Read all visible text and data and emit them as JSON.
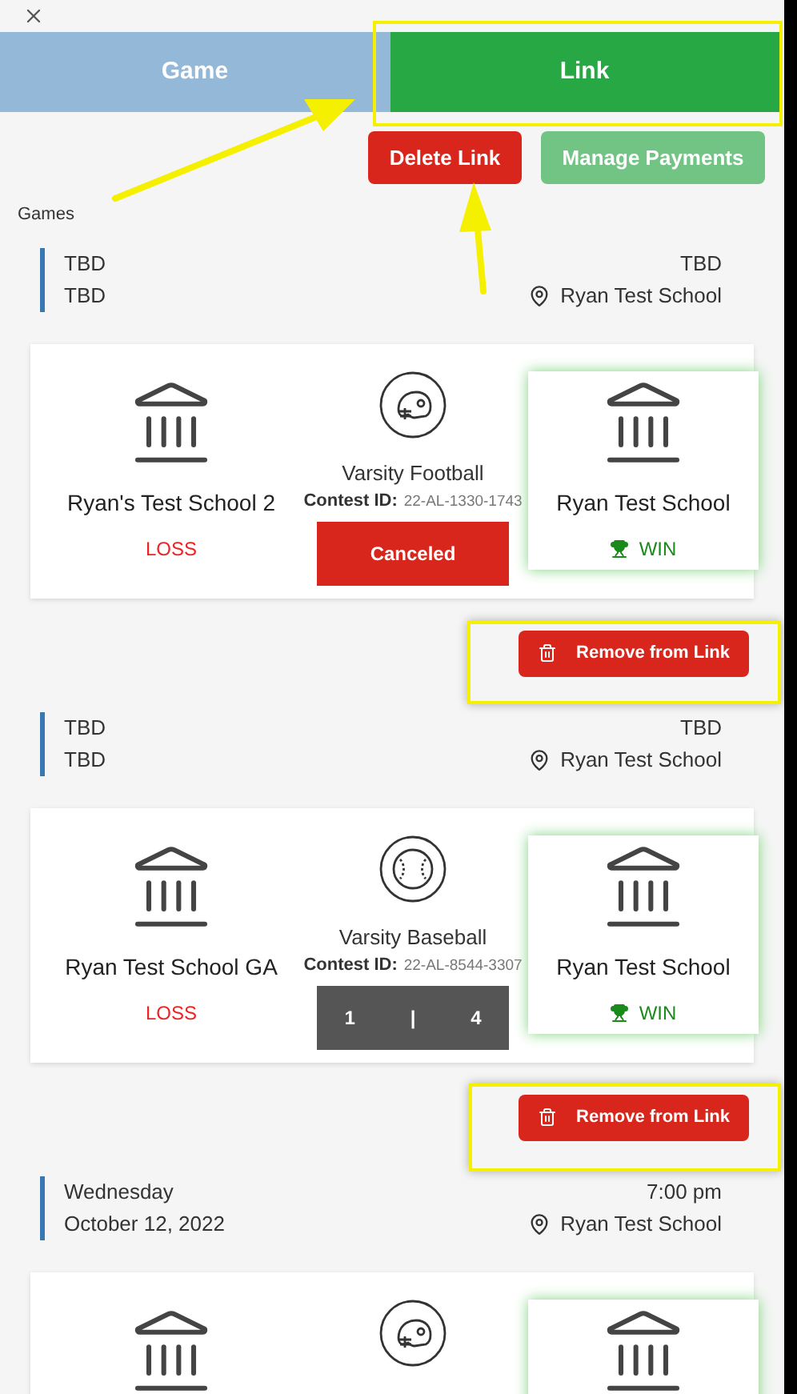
{
  "tabs": [
    {
      "label": "Game",
      "selected": false
    },
    {
      "label": "Link",
      "selected": true
    }
  ],
  "actions": {
    "delete": "Delete Link",
    "manage": "Manage Payments",
    "manage_disabled": true
  },
  "section_title": "Games",
  "games": [
    {
      "date_line1": "TBD",
      "date_line2": "TBD",
      "time": "TBD",
      "location": "Ryan Test School",
      "home": {
        "name": "Ryan's Test School 2",
        "result": "LOSS",
        "winner": false
      },
      "sport": {
        "kind": "football",
        "name": "Varsity Football",
        "contest_id_label": "Contest ID:",
        "contest_id": "22-AL-1330-1743"
      },
      "status": {
        "kind": "canceled",
        "text": "Canceled"
      },
      "away": {
        "name": "Ryan Test School",
        "result": "WIN",
        "winner": true
      },
      "remove_button": "Remove from Link"
    },
    {
      "date_line1": "TBD",
      "date_line2": "TBD",
      "time": "TBD",
      "location": "Ryan Test School",
      "home": {
        "name": "Ryan Test School GA",
        "result": "LOSS",
        "winner": false
      },
      "sport": {
        "kind": "baseball",
        "name": "Varsity Baseball",
        "contest_id_label": "Contest ID:",
        "contest_id": "22-AL-8544-3307"
      },
      "status": {
        "kind": "score",
        "home_score": "1",
        "separator": "|",
        "away_score": "4"
      },
      "away": {
        "name": "Ryan Test School",
        "result": "WIN",
        "winner": true
      },
      "remove_button": "Remove from Link"
    },
    {
      "date_line1": "Wednesday",
      "date_line2": "October 12, 2022",
      "time": "7:00 pm",
      "location": "Ryan Test School",
      "home": {
        "winner": false
      },
      "sport": {
        "kind": "football"
      },
      "away": {
        "winner": true
      }
    }
  ]
}
